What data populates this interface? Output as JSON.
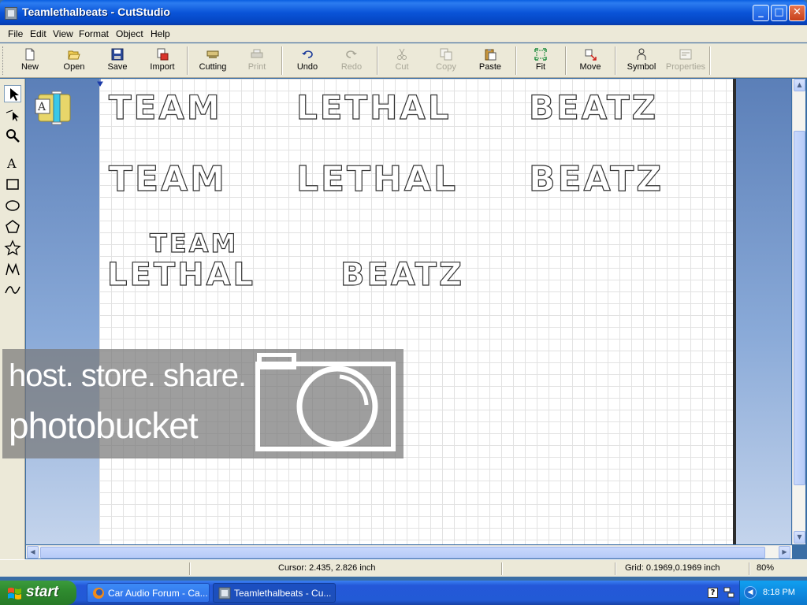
{
  "window": {
    "title": "Teamlethalbeats - CutStudio",
    "minimize": "_",
    "maximize": "□",
    "close": "✕"
  },
  "menu": [
    "File",
    "Edit",
    "View",
    "Format",
    "Object",
    "Help"
  ],
  "toolbar": {
    "new": "New",
    "open": "Open",
    "save": "Save",
    "import": "Import",
    "cutting": "Cutting",
    "print": "Print",
    "undo": "Undo",
    "redo": "Redo",
    "cut": "Cut",
    "copy": "Copy",
    "paste": "Paste",
    "fit": "Fit",
    "move": "Move",
    "symbol": "Symbol",
    "properties": "Properties"
  },
  "tools": [
    "select-tool-icon",
    "node-edit-tool-icon",
    "zoom-tool-icon",
    "text-tool-icon",
    "rectangle-tool-icon",
    "ellipse-tool-icon",
    "polygon-tool-icon",
    "star-tool-icon",
    "polyline-tool-icon",
    "curve-tool-icon"
  ],
  "artwork": {
    "row1": [
      "Team",
      "Lethal",
      "Beatz"
    ],
    "row2": [
      "Team",
      "Lethal",
      "Beatz"
    ],
    "row3_top": "Team",
    "row3_bottom": [
      "Lethal",
      "Beatz"
    ]
  },
  "watermark": {
    "line1": "host. store. share.",
    "line2": "photobucket"
  },
  "status": {
    "cursor": "Cursor: 2.435, 2.826 inch",
    "grid": "Grid: 0.1969,0.1969 inch",
    "zoom": "80%"
  },
  "taskbar": {
    "start": "start",
    "tasks": [
      "Car Audio Forum - Ca...",
      "Teamlethalbeats - Cu..."
    ],
    "help": "?",
    "clock": "8:18 PM"
  },
  "colors": {
    "title_bar": "#0a54d8",
    "start_button": "#2f8b2f",
    "taskbar": "#225ad6",
    "workspace": "#8aaad8"
  }
}
